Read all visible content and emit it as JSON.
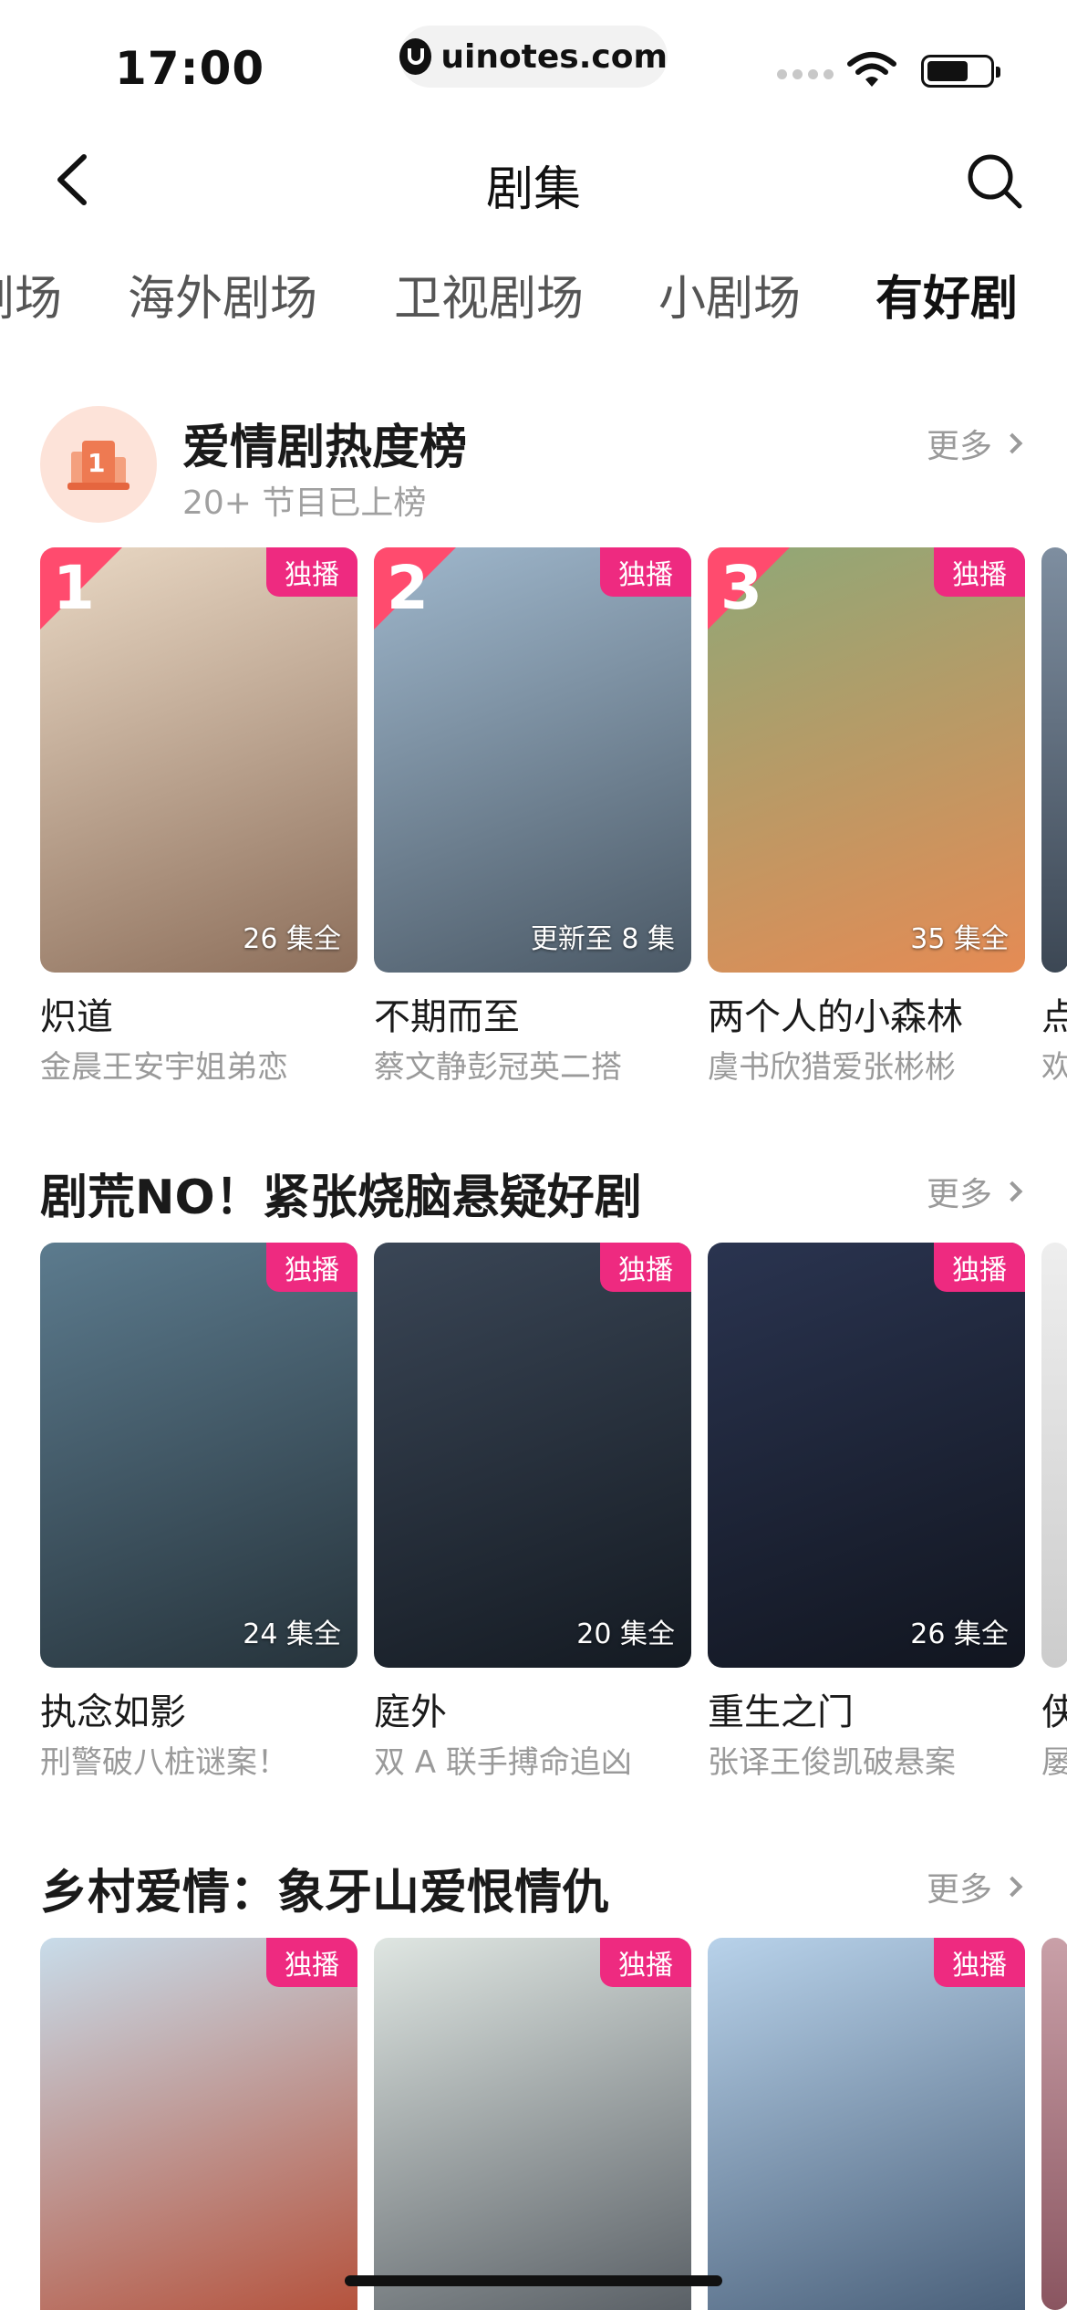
{
  "status": {
    "time": "17:00",
    "url": "uinotes.com"
  },
  "nav": {
    "title": "剧集"
  },
  "tabs": [
    {
      "label": "剧场"
    },
    {
      "label": "海外剧场"
    },
    {
      "label": "卫视剧场"
    },
    {
      "label": "小剧场"
    },
    {
      "label": "有好剧",
      "active": true
    }
  ],
  "sections": [
    {
      "title": "爱情剧热度榜",
      "subtitle": "20+ 节目已上榜",
      "badge_text": "1",
      "more": "更多",
      "cards": [
        {
          "rank": "1",
          "tag": "独播",
          "eps": "26 集全",
          "title": "炽道",
          "sub": "金晨王安宇姐弟恋",
          "bg": [
            "#e9d8c4",
            "#8d6f5b"
          ]
        },
        {
          "rank": "2",
          "tag": "独播",
          "eps": "更新至 8 集",
          "title": "不期而至",
          "sub": "蔡文静彭冠英二搭",
          "bg": [
            "#9fb7cc",
            "#4b5966"
          ]
        },
        {
          "rank": "3",
          "tag": "独播",
          "eps": "35 集全",
          "title": "两个人的小森林",
          "sub": "虞书欣猎爱张彬彬",
          "bg": [
            "#8fa877",
            "#e58b54"
          ]
        },
        {
          "title": "点",
          "sub": "欢"
        }
      ]
    },
    {
      "title": "剧荒NO！紧张烧脑悬疑好剧",
      "more": "更多",
      "cards": [
        {
          "tag": "独播",
          "eps": "24 集全",
          "title": "执念如影",
          "sub": "刑警破八桩谜案！",
          "bg": [
            "#5c7b8e",
            "#26333b"
          ]
        },
        {
          "tag": "独播",
          "eps": "20 集全",
          "title": "庭外",
          "sub": "双 A 联手搏命追凶",
          "bg": [
            "#3a4656",
            "#141a22"
          ]
        },
        {
          "tag": "独播",
          "eps": "26 集全",
          "title": "重生之门",
          "sub": "张译王俊凯破悬案",
          "bg": [
            "#2a3450",
            "#11151f"
          ]
        },
        {
          "title": "侠",
          "sub": "屡"
        }
      ]
    },
    {
      "title": "乡村爱情：象牙山爱恨情仇",
      "more": "更多",
      "cards": [
        {
          "tag": "独播",
          "bg": [
            "#c8dcea",
            "#b5533d"
          ]
        },
        {
          "tag": "独播",
          "bg": [
            "#dfe6e2",
            "#5a6066"
          ]
        },
        {
          "tag": "独播",
          "bg": [
            "#b8d2ea",
            "#4a607a"
          ]
        },
        {}
      ]
    }
  ],
  "colors": {
    "accent": "#ee2a80",
    "rank": "#ff4b6e",
    "muted": "#9a9a9a"
  }
}
